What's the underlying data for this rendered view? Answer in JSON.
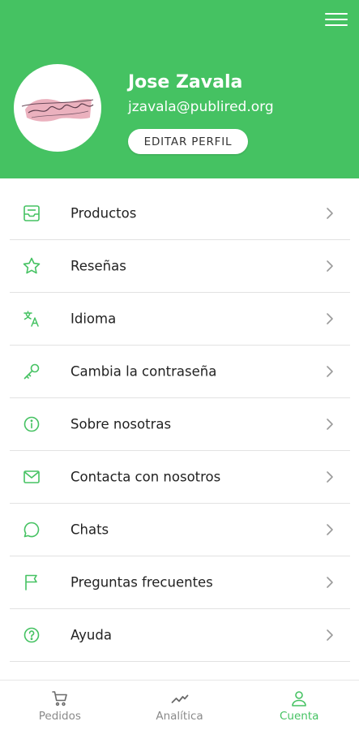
{
  "header": {
    "user_name": "Jose Zavala",
    "user_email": "jzavala@publired.org",
    "edit_profile_label": "EDITAR PERFIL",
    "menu_icon": "hamburger-menu-icon",
    "avatar_logo_text": "Imaginarte",
    "background_color": "#45c262"
  },
  "menu": {
    "items": [
      {
        "label": "Productos",
        "icon": "inbox-tray-icon"
      },
      {
        "label": "Reseñas",
        "icon": "star-icon"
      },
      {
        "label": "Idioma",
        "icon": "translate-icon"
      },
      {
        "label": "Cambia la contraseña",
        "icon": "key-icon"
      },
      {
        "label": "Sobre nosotras",
        "icon": "info-icon"
      },
      {
        "label": "Contacta con nosotros",
        "icon": "mail-icon"
      },
      {
        "label": "Chats",
        "icon": "chat-bubble-icon"
      },
      {
        "label": "Preguntas frecuentes",
        "icon": "flag-icon"
      },
      {
        "label": "Ayuda",
        "icon": "help-circle-icon"
      }
    ]
  },
  "bottom_nav": {
    "items": [
      {
        "label": "Pedidos",
        "icon": "cart-icon",
        "active": false
      },
      {
        "label": "Analítica",
        "icon": "trend-line-icon",
        "active": false
      },
      {
        "label": "Cuenta",
        "icon": "user-icon",
        "active": true
      }
    ]
  },
  "colors": {
    "accent": "#45c262",
    "text": "#222222",
    "inactive": "#8a8a8a",
    "divider": "#e2e2e2"
  }
}
